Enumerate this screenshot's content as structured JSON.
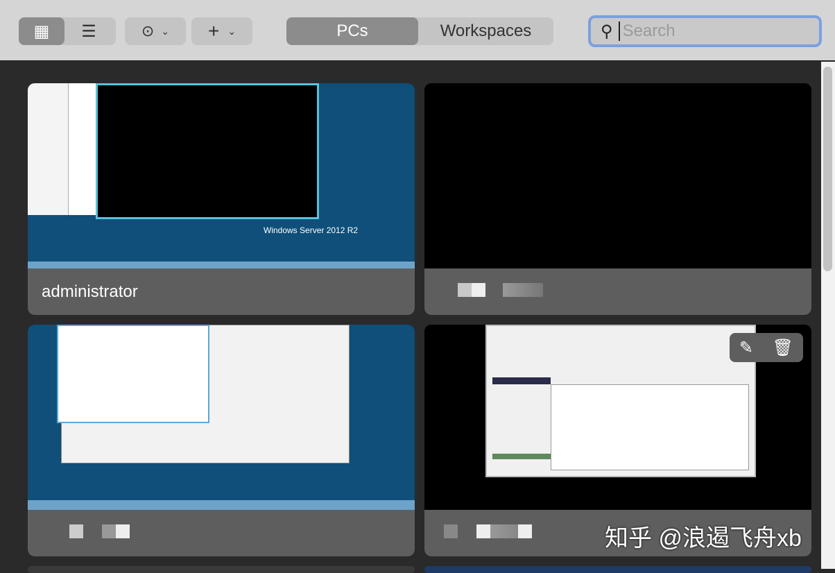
{
  "toolbar": {
    "view_grid_icon": "grid-icon",
    "view_list_icon": "list-icon",
    "more_icon": "ellipsis-circle-icon",
    "add_icon": "plus-icon",
    "tabs": [
      {
        "label": "PCs",
        "selected": true
      },
      {
        "label": "Workspaces",
        "selected": false
      }
    ],
    "search_placeholder": "Search",
    "search_value": ""
  },
  "pcs": [
    {
      "name": "administrator",
      "os_badge": "Windows Server 2012 R2",
      "screen": "windows-desktop-terminal"
    },
    {
      "name": "",
      "screen": "black"
    },
    {
      "name": "",
      "screen": "windows-desktop-task-manager"
    },
    {
      "name": "",
      "screen": "log-window",
      "actions": [
        "pencil-icon",
        "trash-icon"
      ]
    }
  ],
  "watermark": "知乎 @浪遏飞舟xb",
  "colors": {
    "accent": "#7ba0e0",
    "card_label_bg": "#5e5e5e",
    "content_bg": "#2a2a2a"
  }
}
